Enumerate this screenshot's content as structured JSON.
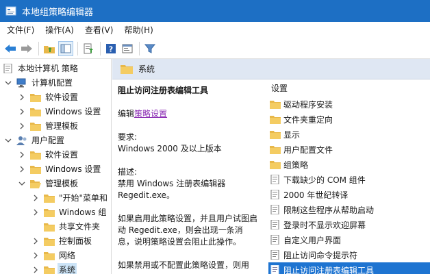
{
  "window": {
    "title": "本地组策略编辑器"
  },
  "menu": [
    {
      "label": "文件(F)"
    },
    {
      "label": "操作(A)"
    },
    {
      "label": "查看(V)"
    },
    {
      "label": "帮助(H)"
    }
  ],
  "toolbar": {
    "buttons": [
      "back-arrow-icon",
      "forward-arrow-icon",
      "up-folder-icon",
      "show-hide-tree-icon",
      "export-list-icon",
      "help-icon",
      "properties-icon",
      "filter-icon"
    ]
  },
  "tree": {
    "items": [
      {
        "label": "本地计算机 策略",
        "level": 0,
        "icon": "computer-policy",
        "expander": "none"
      },
      {
        "label": "计算机配置",
        "level": 1,
        "icon": "computer",
        "expander": "open"
      },
      {
        "label": "软件设置",
        "level": 2,
        "icon": "folder",
        "expander": "closed"
      },
      {
        "label": "Windows 设置",
        "level": 2,
        "icon": "folder",
        "expander": "closed"
      },
      {
        "label": "管理模板",
        "level": 2,
        "icon": "folder",
        "expander": "closed"
      },
      {
        "label": "用户配置",
        "level": 1,
        "icon": "user",
        "expander": "open"
      },
      {
        "label": "软件设置",
        "level": 2,
        "icon": "folder",
        "expander": "closed"
      },
      {
        "label": "Windows 设置",
        "level": 2,
        "icon": "folder",
        "expander": "closed"
      },
      {
        "label": "管理模板",
        "level": 2,
        "icon": "folder",
        "expander": "open"
      },
      {
        "label": "\"开始\"菜单和",
        "level": 3,
        "icon": "folder",
        "expander": "closed"
      },
      {
        "label": "Windows 组",
        "level": 3,
        "icon": "folder",
        "expander": "closed"
      },
      {
        "label": "共享文件夹",
        "level": 3,
        "icon": "folder",
        "expander": "none"
      },
      {
        "label": "控制面板",
        "level": 3,
        "icon": "folder",
        "expander": "closed"
      },
      {
        "label": "网络",
        "level": 3,
        "icon": "folder",
        "expander": "closed"
      },
      {
        "label": "系统",
        "level": 3,
        "icon": "folder",
        "expander": "closed",
        "selected": true
      }
    ]
  },
  "header": {
    "title": "系统"
  },
  "description": {
    "title": "阻止访问注册表编辑工具",
    "edit_prefix": "编辑",
    "edit_link": "策略设置",
    "req_label": "要求:",
    "req_value": "Windows 2000 及以上版本",
    "desc_label": "描述:",
    "desc_text": "禁用 Windows 注册表编辑器 Regedit.exe。",
    "enabled_text": "如果启用此策略设置，并且用户试图启动 Regedit.exe，则会出现一条消息，说明策略设置会阻止此操作。",
    "disabled_text": "如果禁用或不配置此策略设置，则用"
  },
  "list": {
    "header": "设置",
    "items": [
      {
        "label": "驱动程序安装",
        "icon": "folder"
      },
      {
        "label": "文件夹重定向",
        "icon": "folder"
      },
      {
        "label": "显示",
        "icon": "folder"
      },
      {
        "label": "用户配置文件",
        "icon": "folder"
      },
      {
        "label": "组策略",
        "icon": "folder"
      },
      {
        "label": "下载缺少的 COM 组件",
        "icon": "setting"
      },
      {
        "label": "2000 年世纪转译",
        "icon": "setting"
      },
      {
        "label": "限制这些程序从帮助启动",
        "icon": "setting"
      },
      {
        "label": "登录时不显示欢迎屏幕",
        "icon": "setting"
      },
      {
        "label": "自定义用户界面",
        "icon": "setting"
      },
      {
        "label": "阻止访问命令提示符",
        "icon": "setting"
      },
      {
        "label": "阻止访问注册表编辑工具",
        "icon": "setting",
        "selected": true
      }
    ]
  },
  "colors": {
    "titlebar": "#1d6fc4",
    "selection": "#1e74d1",
    "tree_selection": "#cce4f7",
    "folder": "#e8b84a",
    "link": "#8a2bb3"
  }
}
